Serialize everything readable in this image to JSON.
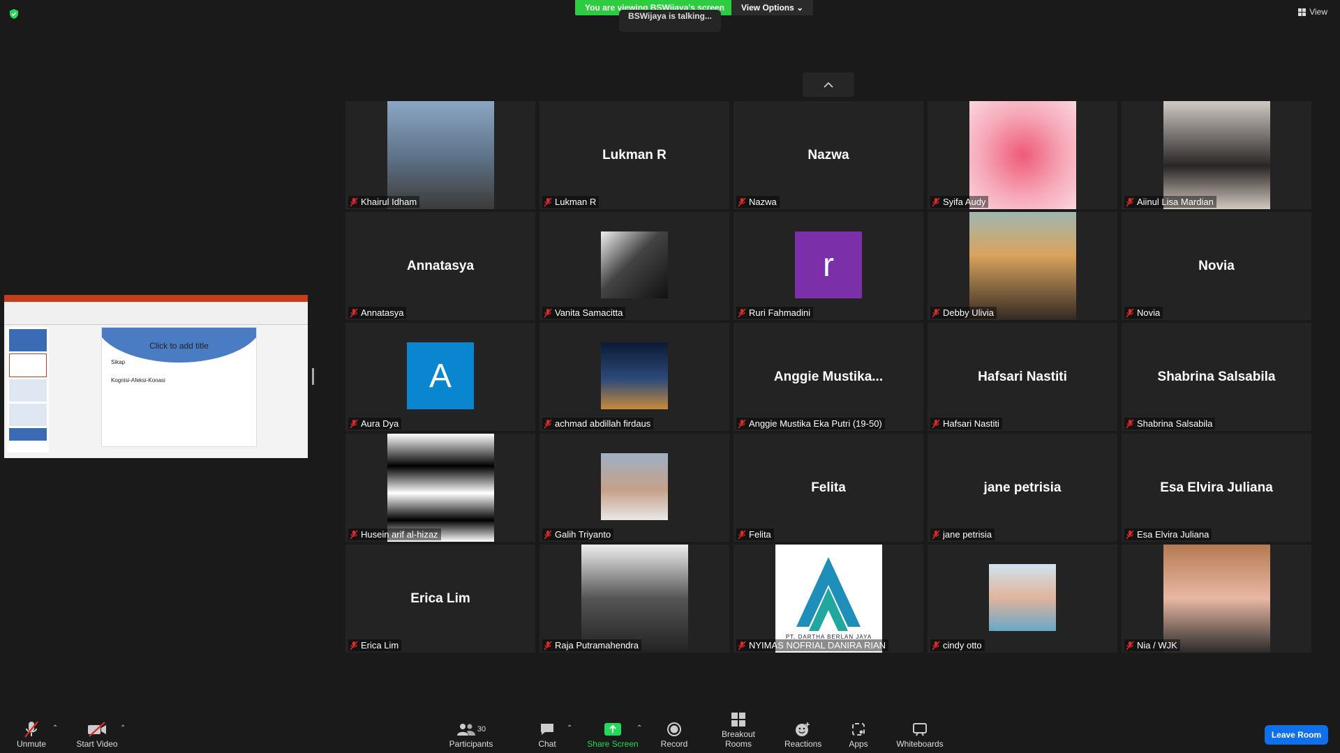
{
  "top": {
    "viewing_banner": "You are viewing BSWijaya's screen",
    "view_options": "View Options",
    "talking": "BSWijaya is talking...",
    "view_label": "View"
  },
  "participants": [
    {
      "name": "Khairul Idham",
      "display": "photo"
    },
    {
      "name": "Lukman R",
      "display": "name"
    },
    {
      "name": "Nazwa",
      "display": "name"
    },
    {
      "name": "Syifa Audy",
      "display": "photo"
    },
    {
      "name": "Aiinul Lisa Mardian",
      "display": "photo"
    },
    {
      "name": "Annatasya",
      "display": "name"
    },
    {
      "name": "Vanita Samacitta",
      "display": "photo"
    },
    {
      "name": "Ruri Fahmadini",
      "display": "avatar",
      "avatar_letter": "r",
      "avatar_color": "#7b2fa8"
    },
    {
      "name": "Debby Ulivia",
      "display": "photo"
    },
    {
      "name": "Novia",
      "display": "name"
    },
    {
      "name": "Aura Dya",
      "display": "avatar",
      "avatar_letter": "A",
      "avatar_color": "#0a85d0"
    },
    {
      "name": "achmad abdillah firdaus",
      "display": "photo"
    },
    {
      "name": "Anggie Mustika Eka Putri (19-50)",
      "display": "name",
      "center_name": "Anggie  Mustika..."
    },
    {
      "name": "Hafsari Nastiti",
      "display": "name"
    },
    {
      "name": "Shabrina Salsabila",
      "display": "name"
    },
    {
      "name": "Husein arif al-hizaz",
      "display": "photo"
    },
    {
      "name": "Galih Triyanto",
      "display": "photo"
    },
    {
      "name": "Felita",
      "display": "name"
    },
    {
      "name": "jane petrisia",
      "display": "name"
    },
    {
      "name": "Esa Elvira Juliana",
      "display": "name"
    },
    {
      "name": "Erica Lim",
      "display": "name"
    },
    {
      "name": "Raja Putramahendra",
      "display": "photo"
    },
    {
      "name": "NYIMAS NOFRIAL DANIRA RIAN",
      "display": "photo",
      "logo_text": "PT. DARTHA BERLAN JAYA"
    },
    {
      "name": "cindy otto",
      "display": "photo"
    },
    {
      "name": "Nia / WJK",
      "display": "photo"
    }
  ],
  "shared_screen": {
    "slide_title": "Click to add title",
    "line1": "Sikap",
    "line2": "Kognisi-Afeksi-Konasi"
  },
  "toolbar": {
    "unmute": "Unmute",
    "start_video": "Start Video",
    "participants": "Participants",
    "participants_count": "30",
    "chat": "Chat",
    "share_screen": "Share Screen",
    "record": "Record",
    "breakout": "Breakout Rooms",
    "reactions": "Reactions",
    "apps": "Apps",
    "whiteboards": "Whiteboards",
    "leave": "Leave Room"
  },
  "colors": {
    "share_green": "#23d959",
    "leave_blue": "#0e71eb",
    "mic_red": "#e02828"
  }
}
